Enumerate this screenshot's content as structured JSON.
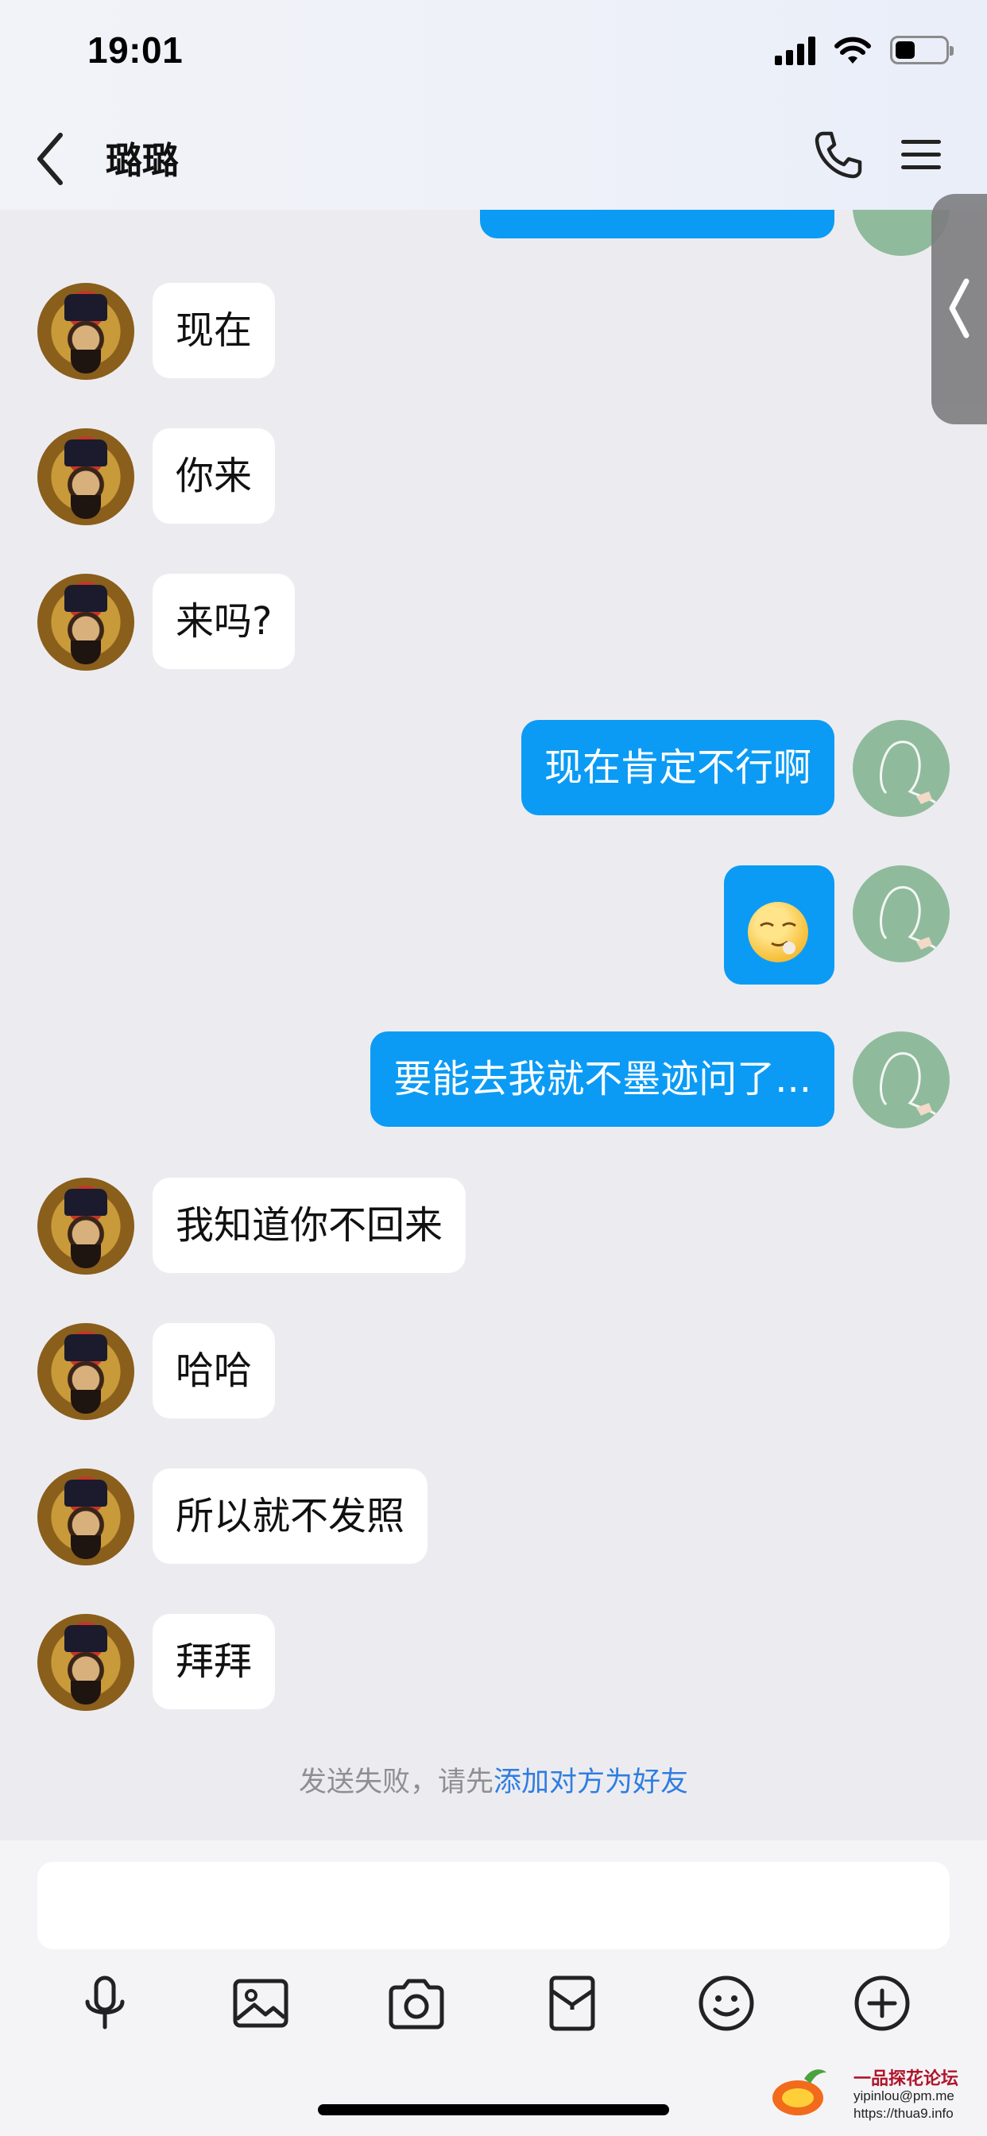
{
  "status_bar": {
    "time": "19:01"
  },
  "header": {
    "contact_name": "璐璐"
  },
  "messages": [
    {
      "side": "recv",
      "text": "现在"
    },
    {
      "side": "recv",
      "text": "你来"
    },
    {
      "side": "recv",
      "text": "来吗?"
    },
    {
      "side": "sent",
      "text": "现在肯定不行啊"
    },
    {
      "side": "sent",
      "emoji": "smirk-face-emoji"
    },
    {
      "side": "sent",
      "text": "要能去我就不墨迹问了..."
    },
    {
      "side": "recv",
      "text": "我知道你不回来"
    },
    {
      "side": "recv",
      "text": "哈哈"
    },
    {
      "side": "recv",
      "text": "所以就不发照"
    },
    {
      "side": "recv",
      "text": "拜拜"
    }
  ],
  "system_note": {
    "prefix": "发送失败，请先",
    "link": "添加对方为好友"
  },
  "toolbar": {
    "icons": [
      "microphone-icon",
      "image-icon",
      "camera-icon",
      "red-packet-icon",
      "smiley-icon",
      "plus-icon"
    ]
  },
  "watermark": {
    "title": "一品探花论坛",
    "email": "yipinlou@pm.me",
    "url": "https://thua9.info"
  },
  "colors": {
    "sent_bubble": "#0b9bf5",
    "recv_bubble": "#ffffff",
    "link": "#2f7de1",
    "background": "#ececf0"
  }
}
